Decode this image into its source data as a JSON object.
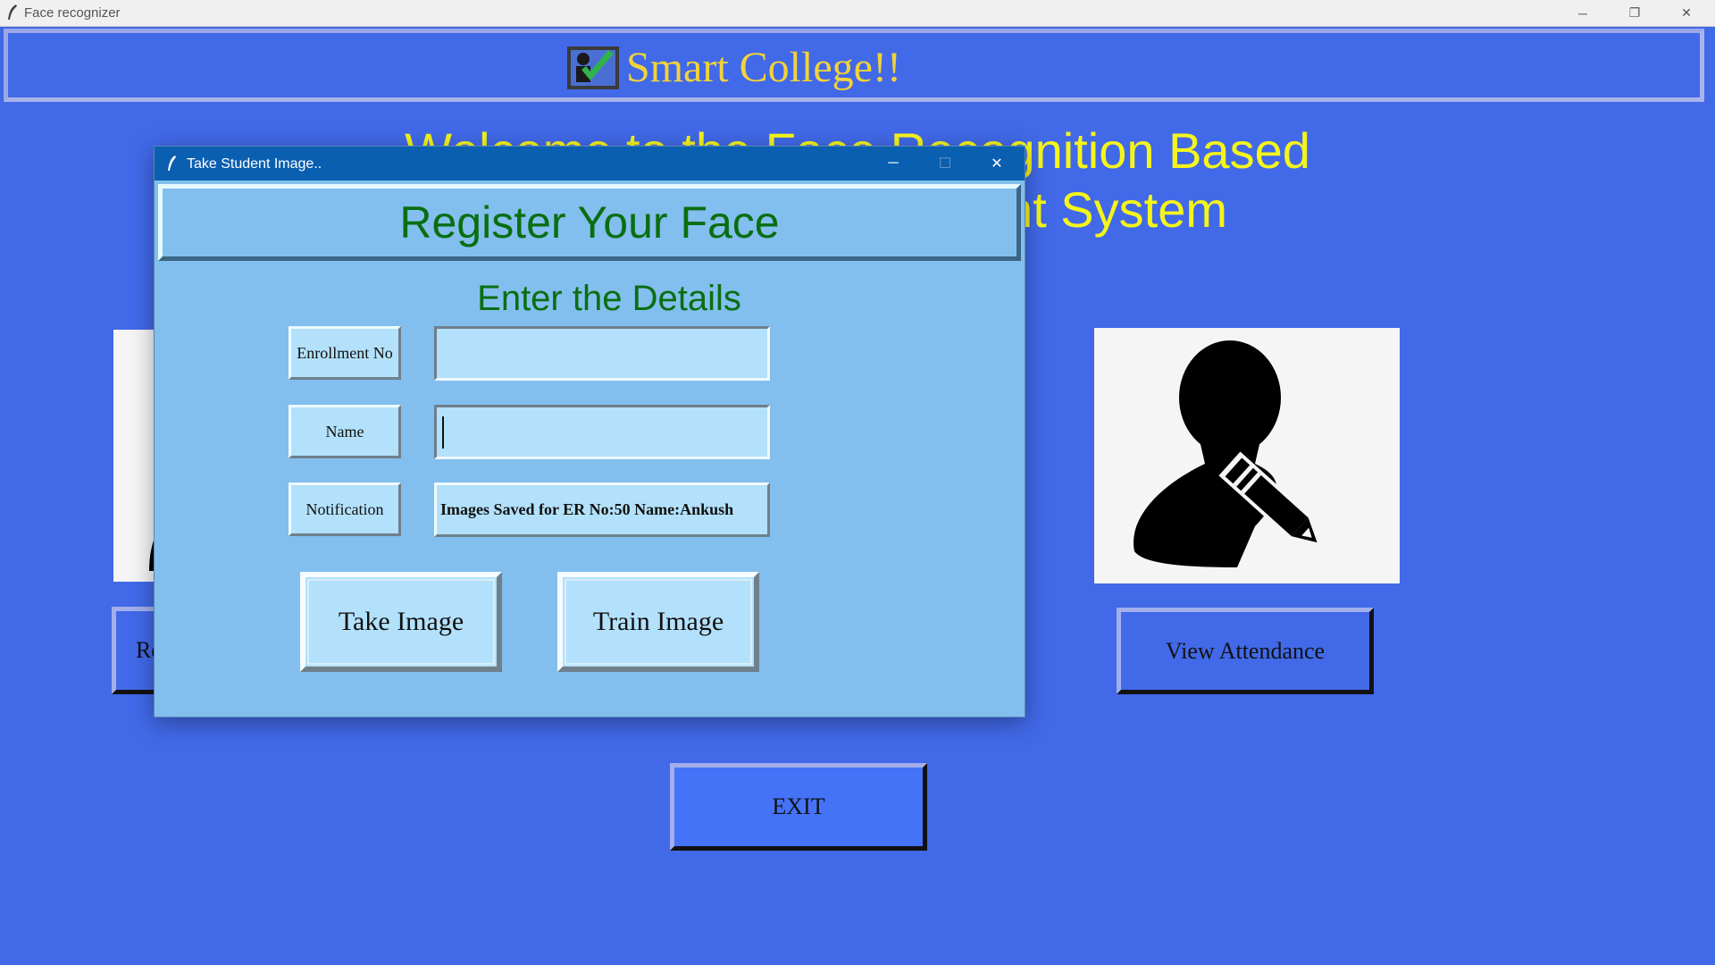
{
  "main_window": {
    "title": "Face recognizer",
    "controls": {
      "minimize": "─",
      "restore": "❐",
      "close": "✕"
    }
  },
  "banner": {
    "brand": "Smart College!!"
  },
  "welcome": {
    "line1": "Welcome to the Face Recognition Based",
    "line2": "Attendance Management System"
  },
  "buttons": {
    "register": "Register a new student",
    "view_attendance": "View Attendance",
    "exit": "EXIT"
  },
  "dialog": {
    "title": "Take Student Image..",
    "controls": {
      "minimize": "─",
      "maximize": "☐",
      "close": "✕"
    },
    "header": "Register Your Face",
    "subheader": "Enter the Details",
    "fields": {
      "enrollment_label": "Enrollment No",
      "enrollment_value": "",
      "name_label": "Name",
      "name_value": "",
      "notification_label": "Notification",
      "notification_value": "Images Saved for ER No:50 Name:Ankush"
    },
    "take_image": "Take Image",
    "train_image": "Train Image"
  },
  "colors": {
    "background": "#4169e8",
    "brand_text": "#f2d23a",
    "welcome_text": "#f5f51a",
    "dialog_bg": "#82bfee",
    "dialog_titlebar": "#0a5fb0",
    "header_text": "#0a6e10",
    "field_bg": "#b3e1fb"
  },
  "icons": {
    "app": "feather-icon",
    "logo": "attendance-checkmark-icon",
    "student": "user-edit-icon"
  }
}
